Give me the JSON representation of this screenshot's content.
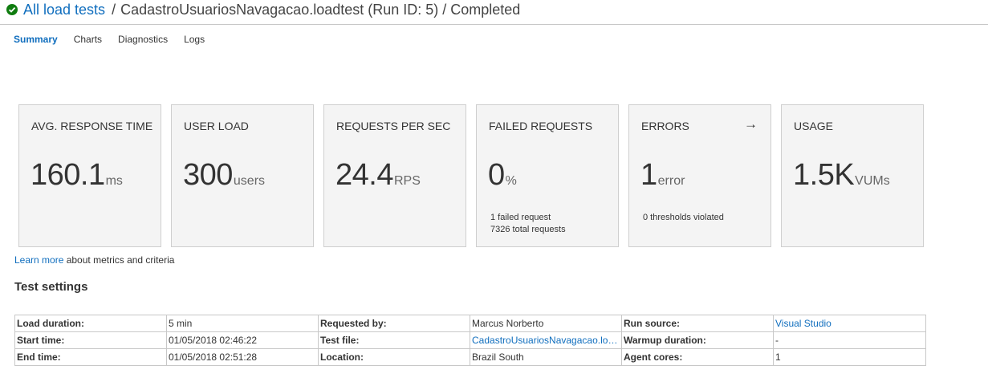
{
  "breadcrumb": {
    "status_icon": "check-circle-icon",
    "status_color": "#107c10",
    "link": "All load tests",
    "separator": "/",
    "title": "CadastroUsuariosNavagacao.loadtest (Run ID: 5) / Completed"
  },
  "tabs": [
    "Summary",
    "Charts",
    "Diagnostics",
    "Logs"
  ],
  "active_tab": "Summary",
  "metrics": {
    "response": {
      "title": "AVG. RESPONSE TIME",
      "value": "160.1",
      "unit": "ms"
    },
    "user_load": {
      "title": "USER LOAD",
      "value": "300",
      "unit": "users"
    },
    "rps": {
      "title": "REQUESTS PER SEC",
      "value": "24.4",
      "unit": "RPS"
    },
    "failed": {
      "title": "FAILED REQUESTS",
      "value": "0",
      "unit": "%",
      "detail1": "1 failed request",
      "detail2": "7326 total requests"
    },
    "errors": {
      "title": "ERRORS",
      "value": "1",
      "unit": "error",
      "detail1": "0 thresholds violated",
      "icon": "arrow-right-icon"
    },
    "usage": {
      "title": "USAGE",
      "value": "1.5K",
      "unit": "VUMs"
    }
  },
  "learn_more": {
    "link": "Learn more",
    "text": " about metrics and criteria"
  },
  "test_settings": {
    "title": "Test settings",
    "rows": [
      [
        "Load duration:",
        "5 min",
        "Requested by:",
        "Marcus Norberto",
        "Run source:",
        "Visual Studio"
      ],
      [
        "Start time:",
        "01/05/2018 02:46:22",
        "Test file:",
        "CadastroUsuariosNavagacao.loadtest",
        "Warmup duration:",
        "-"
      ],
      [
        "End time:",
        "01/05/2018 02:51:28",
        "Location:",
        "Brazil South",
        "Agent cores:",
        "1"
      ]
    ]
  },
  "colors": {
    "accent": "#106ebe",
    "card_bg": "#f4f4f4",
    "success": "#107c10"
  }
}
